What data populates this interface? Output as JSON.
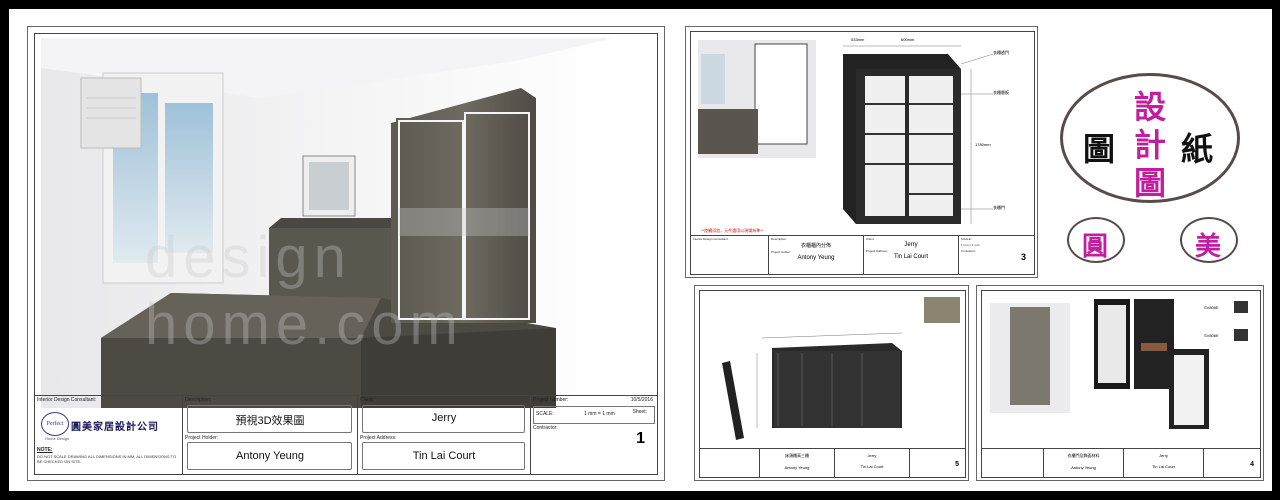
{
  "main_sheet": {
    "watermark": "design home.com",
    "consultant_label": "Interior Design Consultant:",
    "logo_letter": "Perfect",
    "company_name": "圓美家居設計公司",
    "company_tag": "Home Design",
    "note_label": "NOTE:",
    "note_text": "DO NOT SCALE DRAWING ALL DIMENSIONS IN MM, ALL DIMENSIONS TO BE CHECKED ON SITE.",
    "description_label": "Description:",
    "description": "預視3D效果圖",
    "project_holder_label": "Project Holder:",
    "project_holder": "Antony Yeung",
    "client_label": "Client:",
    "client": "Jerry",
    "project_address_label": "Project Address:",
    "project_address": "Tin Lai Court",
    "project_number_label": "Project number:",
    "date": "10/5/2016",
    "scale_label": "SCALE:",
    "scale": "1 mm = 1 mm",
    "contractor_label": "Contractor:",
    "sheet_label": "Sheet:",
    "sheet": "1"
  },
  "sheet3": {
    "note_red": "**陸續添加，元件選用以現場為準**",
    "dims": [
      "533mm",
      "600mm",
      "1780mm"
    ],
    "callouts": [
      "衣櫃趟門",
      "衣櫃層板",
      "衣櫃門"
    ],
    "consultant_label": "Interior Design Consultant:",
    "description_label": "Description:",
    "description": "衣櫃櫃內分佈",
    "project_holder_label": "Project Holder:",
    "project_holder": "Antony Yeung",
    "client_label": "Client:",
    "client": "Jerry",
    "project_address_label": "Project Address:",
    "project_address": "Tin Lai Court",
    "scale_label": "SCALE:",
    "scale": "1 mm = 1 mm",
    "contractor_label": "Contractor:",
    "sheet": "3"
  },
  "sheet5": {
    "description": "床頭櫃高三櫃",
    "project_holder": "Antony Yeung",
    "client": "Jerry",
    "project_address": "Tin Lai Court",
    "sheet": "5"
  },
  "sheet4": {
    "description": "衣櫃門及飾面材料",
    "project_holder": "Antony Yeung",
    "client": "Jerry",
    "project_address": "Tin Lai Court",
    "sheet": "4",
    "labels": [
      "SV806E",
      "SV806E"
    ]
  },
  "badge": {
    "left": "圖",
    "center": [
      "設",
      "計",
      "圖"
    ],
    "right": "紙",
    "small_left": "圓",
    "small_right": "美"
  }
}
